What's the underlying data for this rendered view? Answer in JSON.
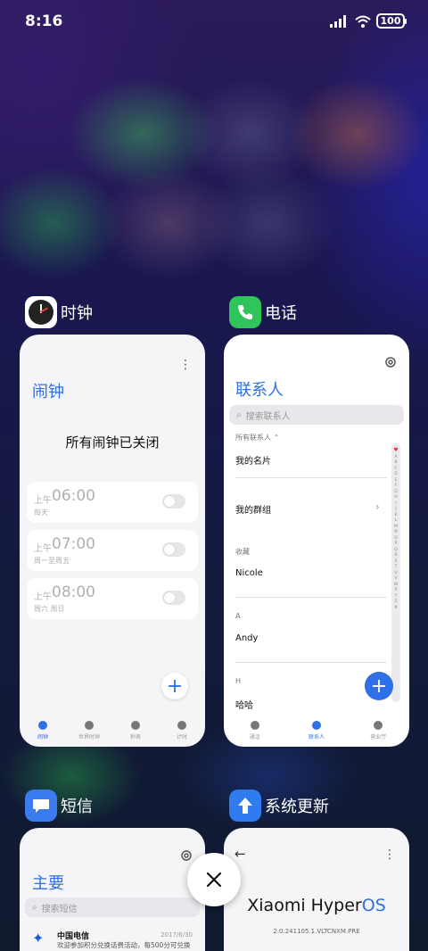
{
  "status_bar": {
    "time": "8:16",
    "battery": "100"
  },
  "clock_app": {
    "name": "时钟",
    "title": "闹钟",
    "empty_text": "所有闹钟已关闭",
    "alarms": [
      {
        "ampm": "上午",
        "time": "06:00",
        "days": "每天"
      },
      {
        "ampm": "上午",
        "time": "07:00",
        "days": "周一至周五"
      },
      {
        "ampm": "上午",
        "time": "08:00",
        "days": "周六 周日"
      }
    ],
    "nav": [
      "闹钟",
      "世界时钟",
      "秒表",
      "计时"
    ]
  },
  "phone_app": {
    "name": "电话",
    "title": "联系人",
    "search_placeholder": "搜索联系人",
    "all_contacts": "所有联系人 ⌃",
    "my_card": "我的名片",
    "my_groups": "我的群组",
    "favorites_label": "收藏",
    "favorite_1": "Nicole",
    "section_a": "A",
    "contact_a": "Andy",
    "section_h": "H",
    "contact_h": "哈哈",
    "index_letters": [
      "A",
      "B",
      "C",
      "D",
      "E",
      "F",
      "G",
      "H",
      "I",
      "J",
      "K",
      "L",
      "M",
      "N",
      "O",
      "P",
      "Q",
      "R",
      "S",
      "T",
      "U",
      "V",
      "W",
      "X",
      "Y",
      "Z",
      "#"
    ],
    "nav": [
      "通话",
      "联系人",
      "营业厅"
    ]
  },
  "sms_app": {
    "name": "短信",
    "title": "主要",
    "search_placeholder": "搜索短信",
    "messages": [
      {
        "sender": "中国电信",
        "date": "2017/6/30",
        "preview": "欢迎参加积分兑换话费活动，每500分可兑换"
      }
    ]
  },
  "update_app": {
    "name": "系统更新",
    "os_name_main": "Xiaomi Hyper",
    "os_name_accent": "OS",
    "version": "2.0.241105.1.VLTCNXM.PRE"
  },
  "close_all": {
    "label": "×"
  }
}
